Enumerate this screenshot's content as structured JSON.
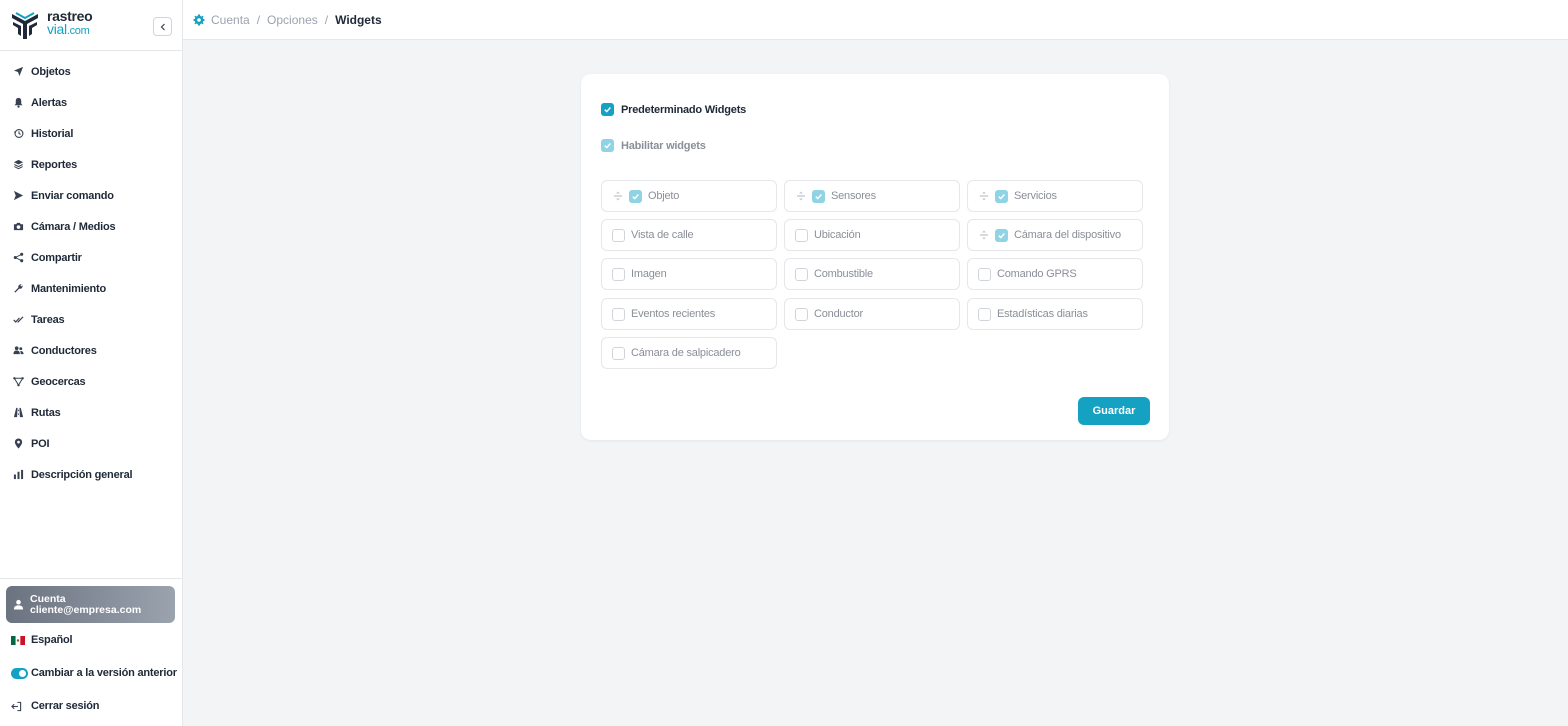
{
  "brand": {
    "line1": "rastreo",
    "line2": "vial",
    "line2_suffix": ".com",
    "accent": "#14a1c2"
  },
  "sidebar": {
    "items": [
      {
        "label": "Objetos",
        "icon": "navigation-arrow-icon"
      },
      {
        "label": "Alertas",
        "icon": "bell-icon"
      },
      {
        "label": "Historial",
        "icon": "history-icon"
      },
      {
        "label": "Reportes",
        "icon": "layers-icon"
      },
      {
        "label": "Enviar comando",
        "icon": "send-icon"
      },
      {
        "label": "Cámara / Medios",
        "icon": "camera-icon"
      },
      {
        "label": "Compartir",
        "icon": "share-icon"
      },
      {
        "label": "Mantenimiento",
        "icon": "wrench-icon"
      },
      {
        "label": "Tareas",
        "icon": "double-check-icon"
      },
      {
        "label": "Conductores",
        "icon": "users-icon"
      },
      {
        "label": "Geocercas",
        "icon": "geofence-icon"
      },
      {
        "label": "Rutas",
        "icon": "route-icon"
      },
      {
        "label": "POI",
        "icon": "map-pin-icon"
      },
      {
        "label": "Descripción general",
        "icon": "bar-chart-icon"
      }
    ],
    "account": {
      "title": "Cuenta",
      "email": "cliente@empresa.com"
    },
    "language": "Español",
    "legacy_toggle": "Cambiar a la versión anterior",
    "logout": "Cerrar sesión"
  },
  "breadcrumb": {
    "root": "Cuenta",
    "middle": "Opciones",
    "current": "Widgets",
    "sep": "/"
  },
  "widgets": {
    "default_label": "Predeterminado Widgets",
    "default_checked": true,
    "enable_label": "Habilitar widgets",
    "enable_checked": true,
    "items": [
      {
        "label": "Objeto",
        "checked": true
      },
      {
        "label": "Sensores",
        "checked": true
      },
      {
        "label": "Servicios",
        "checked": true
      },
      {
        "label": "Vista de calle",
        "checked": false
      },
      {
        "label": "Ubicación",
        "checked": false
      },
      {
        "label": "Cámara del dispositivo",
        "checked": true
      },
      {
        "label": "Imagen",
        "checked": false
      },
      {
        "label": "Combustible",
        "checked": false
      },
      {
        "label": "Comando GPRS",
        "checked": false
      },
      {
        "label": "Eventos recientes",
        "checked": false
      },
      {
        "label": "Conductor",
        "checked": false
      },
      {
        "label": "Estadísticas diarias",
        "checked": false
      },
      {
        "label": "Cámara de salpicadero",
        "checked": false
      }
    ],
    "save_label": "Guardar"
  }
}
